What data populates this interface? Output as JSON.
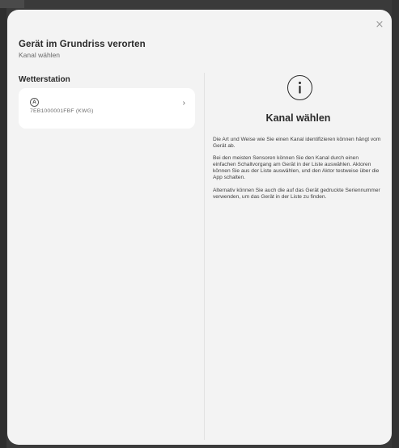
{
  "dialog": {
    "title": "Gerät im Grundriss verorten",
    "subtitle": "Kanal wählen",
    "close_label": "×"
  },
  "left": {
    "section_title": "Wetterstation",
    "device": {
      "icon": "channel-a-icon",
      "icon_glyph": "A",
      "serial": "7EB1000001FBF (KWG)",
      "chevron": "›"
    }
  },
  "right": {
    "icon": "info-icon",
    "title": "Kanal wählen",
    "paragraphs": [
      "Die Art und Weise wie Sie einen Kanal identifizieren können hängt vom Gerät ab.",
      "Bei den meisten Sensoren können Sie den Kanal durch einen einfachen Schaltvorgang am Gerät in der Liste auswählen. Aktoren können Sie aus der Liste auswählen, und den Aktor testweise über die App schalten.",
      "Alternativ können Sie auch die auf das Gerät gedruckte Seriennummer verwenden, um das Gerät in der Liste zu finden."
    ]
  },
  "colors": {
    "backdrop": "#3a3a3a",
    "modal_bg": "#f3f3f3",
    "card_bg": "#ffffff",
    "text_primary": "#2a2a2a",
    "text_secondary": "#6a6a6a"
  }
}
